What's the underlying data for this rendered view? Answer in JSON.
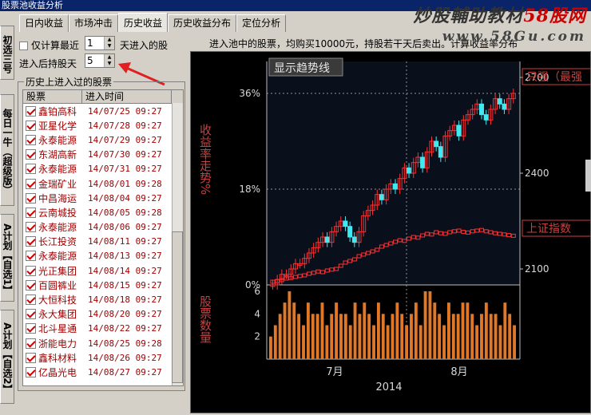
{
  "window": {
    "title": "股票池收益分析"
  },
  "watermark": {
    "line1_prefix": "炒股輔助教材",
    "line1_brand": "58股网",
    "line2": "www.58Gu.com"
  },
  "side_tabs": [
    "初选三号",
    "每日一牛（超级版）",
    "A计划【自选1】",
    "A计划【自选2】"
  ],
  "tabs": [
    "日内收益",
    "市场冲击",
    "历史收益",
    "历史收益分布",
    "定位分析"
  ],
  "active_tab": 2,
  "options": {
    "only_recent_label": "仅计算最近",
    "only_recent_value": "1",
    "only_recent_suffix": "天进入的股",
    "hold_days_label": "进入后持股天",
    "hold_days_value": "5"
  },
  "info_text": "进入池中的股票，均购买10000元，持股若干天后卖出。计算收益率分布",
  "history": {
    "group_label": "历史上进入过的股票",
    "columns": [
      "股票",
      "进入时间"
    ],
    "rows": [
      {
        "name": "鑫铂高科",
        "time": "14/07/25 09:27"
      },
      {
        "name": "亚星化学",
        "time": "14/07/28 09:27"
      },
      {
        "name": "永泰能源",
        "time": "14/07/29 09:27"
      },
      {
        "name": "东湖高新",
        "time": "14/07/30 09:27"
      },
      {
        "name": "永泰能源",
        "time": "14/07/31 09:27"
      },
      {
        "name": "金瑞矿业",
        "time": "14/08/01 09:28"
      },
      {
        "name": "中昌海运",
        "time": "14/08/04 09:27"
      },
      {
        "name": "云南城投",
        "time": "14/08/05 09:28"
      },
      {
        "name": "永泰能源",
        "time": "14/08/06 09:27"
      },
      {
        "name": "长江投资",
        "time": "14/08/11 09:27"
      },
      {
        "name": "永泰能源",
        "time": "14/08/13 09:27"
      },
      {
        "name": "光正集团",
        "time": "14/08/14 09:27"
      },
      {
        "name": "百圆裤业",
        "time": "14/08/15 09:27"
      },
      {
        "name": "大恒科技",
        "time": "14/08/18 09:27"
      },
      {
        "name": "永大集团",
        "time": "14/08/20 09:27"
      },
      {
        "name": "北斗星通",
        "time": "14/08/22 09:27"
      },
      {
        "name": "浙能电力",
        "time": "14/08/25 09:28"
      },
      {
        "name": "鑫科材料",
        "time": "14/08/26 09:27"
      },
      {
        "name": "亿晶光电",
        "time": "14/08/27 09:27"
      }
    ]
  },
  "chart": {
    "button": "显示趋势线",
    "ylabel_left": "收益率走势%",
    "ylabel_bottom": "股票数量",
    "legend_red": "只强（最强",
    "legend_index": "上证指数",
    "left_ticks": [
      "36%",
      "18%",
      "0%"
    ],
    "right_ticks": [
      "2700",
      "2400",
      "2100"
    ],
    "count_ticks": [
      "6",
      "4",
      "2"
    ],
    "x_ticks": [
      "7月",
      "8月"
    ],
    "x_year": "2014",
    "colors": {
      "up": "#ff3030",
      "down": "#40e8f0",
      "grid": "#909090",
      "bar": "#e07828",
      "text": "#c84040",
      "axis_text": "#d8d8d8"
    }
  },
  "chart_data": {
    "type": "candlestick",
    "series": [
      {
        "name": "只强（最强",
        "values": [
          0,
          1,
          2,
          2,
          3,
          4,
          4,
          5,
          6,
          7,
          8,
          9,
          8,
          10,
          11,
          12,
          11,
          9,
          8,
          10,
          13,
          14,
          15,
          17,
          16,
          18,
          19,
          18,
          20,
          22,
          21,
          23,
          24,
          22,
          25,
          27,
          26,
          24,
          28,
          29,
          30,
          28,
          31,
          32,
          33,
          34,
          32,
          31,
          33,
          35,
          34,
          33,
          35,
          36
        ]
      },
      {
        "name": "上证指数",
        "values": [
          2060,
          2062,
          2065,
          2070,
          2072,
          2075,
          2078,
          2080,
          2085,
          2088,
          2092,
          2090,
          2095,
          2098,
          2100,
          2110,
          2120,
          2125,
          2130,
          2140,
          2145,
          2150,
          2155,
          2160,
          2170,
          2175,
          2180,
          2185,
          2190,
          2188,
          2195,
          2200,
          2198,
          2205,
          2210,
          2208,
          2215,
          2212,
          2210,
          2215,
          2218,
          2220,
          2216,
          2214,
          2218,
          2220,
          2222,
          2218,
          2215,
          2212,
          2210,
          2208,
          2206,
          2204
        ]
      },
      {
        "name": "股票数量",
        "values": [
          2,
          3,
          4,
          5,
          6,
          5,
          4,
          3,
          5,
          4,
          4,
          5,
          3,
          4,
          5,
          4,
          4,
          3,
          5,
          4,
          5,
          4,
          3,
          5,
          4,
          3,
          4,
          5,
          4,
          3,
          4,
          5,
          3,
          6,
          6,
          5,
          4,
          3,
          5,
          4,
          4,
          5,
          5,
          4,
          3,
          4,
          5,
          4,
          4,
          3,
          5,
          4,
          3
        ]
      }
    ],
    "y_left": [
      0,
      36
    ],
    "y_right": [
      2100,
      2700
    ]
  }
}
